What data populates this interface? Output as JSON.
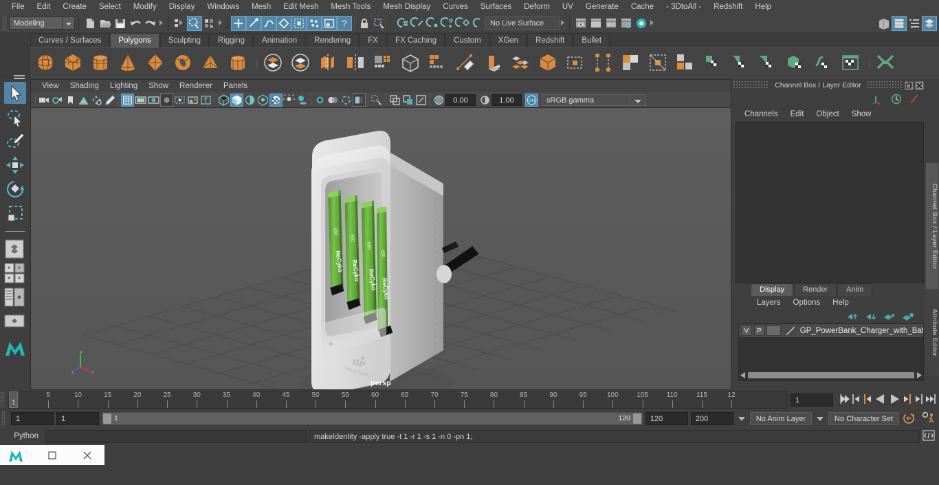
{
  "app": {
    "name": "Autodesk Maya"
  },
  "menubar": {
    "items": [
      "File",
      "Edit",
      "Create",
      "Select",
      "Modify",
      "Display",
      "Windows",
      "Mesh",
      "Edit Mesh",
      "Mesh Tools",
      "Mesh Display",
      "Curves",
      "Surfaces",
      "Deform",
      "UV",
      "Generate",
      "Cache",
      "- 3DtoAll -",
      "Redshift",
      "Help"
    ]
  },
  "statusline": {
    "menuset": "Modeling",
    "live_surface": "No Live Surface",
    "icons": [
      "new-scene-icon",
      "open-scene-icon",
      "save-scene-icon",
      "undo-icon",
      "redo-icon",
      "select-by-hierarchy-icon",
      "select-by-object-icon",
      "select-by-component-icon",
      "snap-to-grid-icon",
      "snap-to-curve-icon",
      "snap-to-point-icon",
      "snap-to-projected-center-icon",
      "snap-to-view-plane-icon",
      "make-live-icon",
      "render-current-frame-icon",
      "ipr-render-icon",
      "render-settings-icon",
      "hypershade-icon",
      "open-render-view-icon",
      "sidebar-toggle-attribute-editor-icon",
      "sidebar-toggle-tool-settings-icon",
      "sidebar-toggle-channel-box-icon"
    ]
  },
  "shelf": {
    "tabs": [
      "Curves / Surfaces",
      "Polygons",
      "Sculpting",
      "Rigging",
      "Animation",
      "Rendering",
      "FX",
      "FX Caching",
      "Custom",
      "XGen",
      "Redshift",
      "Bullet"
    ],
    "active_tab": "Polygons",
    "items": [
      "poly-sphere",
      "poly-cube",
      "poly-cylinder",
      "poly-cone",
      "poly-platonic",
      "poly-torus",
      "poly-pyramid",
      "poly-prism",
      "combine",
      "separate",
      "extract",
      "mirror-geometry",
      "poly-smooth",
      "booleans",
      "quad-draw",
      "multi-cut",
      "bevel",
      "bridge",
      "append-polygon",
      "insert-edge-loop",
      "offset-edge-loop",
      "connect-components",
      "detach",
      "slide-edge",
      "transfer-attributes",
      "transfer-vertex-order",
      "transfer-uv",
      "crease-tool",
      "paint-attributes",
      "uv-editor",
      "uv-unfold"
    ]
  },
  "toolbox": {
    "items": [
      {
        "name": "select-tool",
        "selected": true
      },
      {
        "name": "lasso-select-tool",
        "selected": false
      },
      {
        "name": "paint-select-tool",
        "selected": false
      },
      {
        "name": "move-tool",
        "selected": false
      },
      {
        "name": "rotate-tool",
        "selected": false
      },
      {
        "name": "scale-tool",
        "selected": false
      },
      {
        "name": "last-tool-used",
        "selected": false
      },
      {
        "name": "single-perspective-view-layout",
        "selected": false
      },
      {
        "name": "four-view-layout",
        "selected": false
      },
      {
        "name": "outliner-persp-layout",
        "selected": false
      },
      {
        "name": "persp-graph-layout",
        "selected": false
      },
      {
        "name": "maya-logo",
        "selected": false
      }
    ]
  },
  "viewport": {
    "menus": [
      "View",
      "Shading",
      "Lighting",
      "Show",
      "Renderer",
      "Panels"
    ],
    "exposure": "0.00",
    "gamma": "1.00",
    "color_profile": "sRGB gamma",
    "camera_label": "persp",
    "toolbar_icons": [
      "select-camera-icon",
      "camera-attributes-icon",
      "bookmarks-icon",
      "image-plane-icon",
      "2d-pan-zoom-icon",
      "grease-pencil-icon",
      "grid-toggle-icon",
      "film-gate-icon",
      "resolution-gate-icon",
      "gate-mask-icon",
      "film-origin-icon",
      "light-manip-icon",
      "text-overlay-icon",
      "wireframe-icon",
      "smooth-shade-icon",
      "shaded-wireframe-icon",
      "use-default-material-icon",
      "textured-icon",
      "use-all-lights-icon",
      "shadows-icon",
      "screen-space-ao-icon",
      "motion-blur-icon",
      "multisample-icon",
      "depth-of-field-icon",
      "isolate-select-icon",
      "xray-icon",
      "xray-joints-icon",
      "xray-active-components-icon",
      "exposure-icon",
      "gamma-icon",
      "color-management-toggle-icon"
    ],
    "model": {
      "object": "GP PowerBank Charger with Batteries",
      "battery_label_brand": "GP",
      "battery_label_line": "ReCyko",
      "battery_capacity": "650",
      "body_text": "GP PowerBank",
      "battery_count": 4
    }
  },
  "channel_box": {
    "title": "Channel Box / Layer Editor",
    "menus": [
      "Channels",
      "Edit",
      "Object",
      "Show"
    ],
    "window_buttons": [
      "restore-icon",
      "close-icon"
    ],
    "header_icons": [
      "axis-gizmo-icon",
      "clock-icon",
      "slash-icon"
    ],
    "empty": ""
  },
  "side_tabs": [
    {
      "label": "Channel Box / Layer Editor",
      "active": true
    },
    {
      "label": "Attribute Editor",
      "active": false
    }
  ],
  "layer_editor": {
    "tabs": [
      "Display",
      "Render",
      "Anim"
    ],
    "active_tab": "Display",
    "menus": [
      "Layers",
      "Options",
      "Help"
    ],
    "buttons": [
      "move-layer-up-icon",
      "move-layer-down-icon",
      "create-new-layer-icon",
      "create-layer-from-selected-icon"
    ],
    "layers": [
      {
        "visibility": "V",
        "playback": "P",
        "color": "",
        "name": "GP_PowerBank_Charger_with_Batteri"
      }
    ]
  },
  "timeline": {
    "labels": [
      "5",
      "10",
      "15",
      "20",
      "25",
      "30",
      "35",
      "40",
      "45",
      "50",
      "55",
      "60",
      "65",
      "70",
      "75",
      "80",
      "85",
      "90",
      "95",
      "100",
      "105",
      "110",
      "115",
      "12"
    ],
    "current_frame": "1",
    "current_frame_field": "1",
    "playback_buttons": [
      "go-to-start-icon",
      "step-back-keyframe-icon",
      "step-back-frame-icon",
      "play-backwards-icon",
      "play-forwards-icon",
      "step-forward-frame-icon",
      "step-forward-keyframe-icon",
      "go-to-end-icon"
    ]
  },
  "range": {
    "anim_start": "1",
    "range_start": "1",
    "slider_start": "1",
    "slider_end": "120",
    "range_end": "120",
    "anim_end": "200",
    "anim_layer": "No Anim Layer",
    "character_set": "No Character Set",
    "buttons": [
      "auto-keyframe-icon",
      "animation-preferences-icon"
    ]
  },
  "command_line": {
    "language": "Python",
    "input_value": "",
    "output": "makeIdentity -apply true -t 1 -r 1 -s 1 -n 0 -pn 1;",
    "script-editor-button": "script-editor-icon"
  },
  "taskbar": {
    "items": [
      "maya-app-icon",
      "maximize-window-icon",
      "close-window-icon"
    ]
  },
  "colors": {
    "accent_blue": "#5285a6",
    "accent_teal": "#4db3b3",
    "accent_orange": "#e08a3c",
    "panel_bg": "#3f3f3f",
    "viewport_bg": "#5a5a5a",
    "battery_green": "#5fa539"
  }
}
